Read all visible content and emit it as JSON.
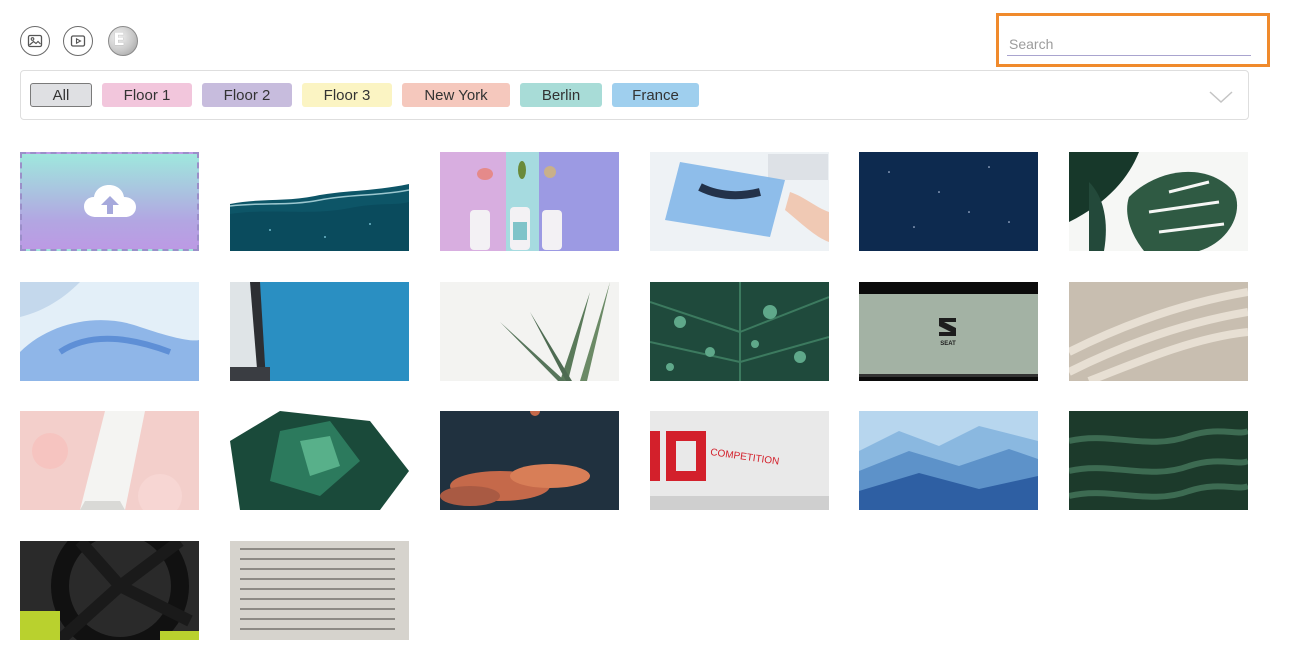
{
  "toolbar": {
    "buttons": [
      {
        "icon": "image-icon"
      },
      {
        "icon": "video-icon"
      },
      {
        "icon": "e-logo-icon",
        "label": "E"
      }
    ]
  },
  "search": {
    "placeholder": "Search",
    "value": "",
    "highlight_color": "#f08a2c"
  },
  "filters": {
    "chips": [
      {
        "label": "All",
        "color": "#dfe0e3",
        "selected": true
      },
      {
        "label": "Floor 1",
        "color": "#f2c6dc"
      },
      {
        "label": "Floor 2",
        "color": "#c7bcdd"
      },
      {
        "label": "Floor 3",
        "color": "#fbf4c3"
      },
      {
        "label": "New York",
        "color": "#f5c8bd"
      },
      {
        "label": "Berlin",
        "color": "#a8dcd7"
      },
      {
        "label": "France",
        "color": "#9fcfee"
      }
    ],
    "toggle_icon": "chevron-down-icon"
  },
  "upload_tile": {
    "icon": "cloud-upload-icon"
  },
  "media": [
    {
      "subject": "water-waves"
    },
    {
      "subject": "cosmetic-bottles"
    },
    {
      "subject": "xray-hands"
    },
    {
      "subject": "night-sky"
    },
    {
      "subject": "monstera-leaves"
    },
    {
      "subject": "gloved-hand"
    },
    {
      "subject": "monitor-edge"
    },
    {
      "subject": "plant-leaves"
    },
    {
      "subject": "leaf-droplets"
    },
    {
      "subject": "seat-video",
      "text": "SEAT"
    },
    {
      "subject": "beige-waves"
    },
    {
      "subject": "cream-tube"
    },
    {
      "subject": "green-crystal"
    },
    {
      "subject": "orange-clouds"
    },
    {
      "subject": "competition-car",
      "text": "COMPETITION"
    },
    {
      "subject": "blue-mountains"
    },
    {
      "subject": "dark-water"
    },
    {
      "subject": "car-wheel"
    },
    {
      "subject": "text-document"
    }
  ]
}
